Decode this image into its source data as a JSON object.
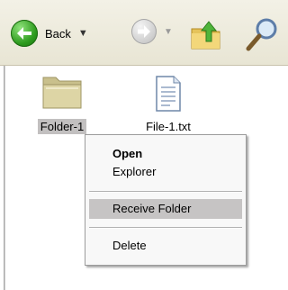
{
  "toolbar": {
    "back_label": "Back",
    "back_icon": "back-arrow-icon",
    "forward_icon": "forward-arrow-icon",
    "up_icon": "folder-up-icon",
    "search_icon": "search-icon",
    "back_color": "#2e9b1e"
  },
  "items": [
    {
      "label": "Folder-1",
      "icon": "folder-icon",
      "selected": true
    },
    {
      "label": "File-1.txt",
      "icon": "text-file-icon",
      "selected": false
    }
  ],
  "context_menu": {
    "open_label": "Open",
    "explorer_label": "Explorer",
    "receive_folder_label": "Receive Folder",
    "delete_label": "Delete",
    "highlighted": "Receive Folder"
  }
}
